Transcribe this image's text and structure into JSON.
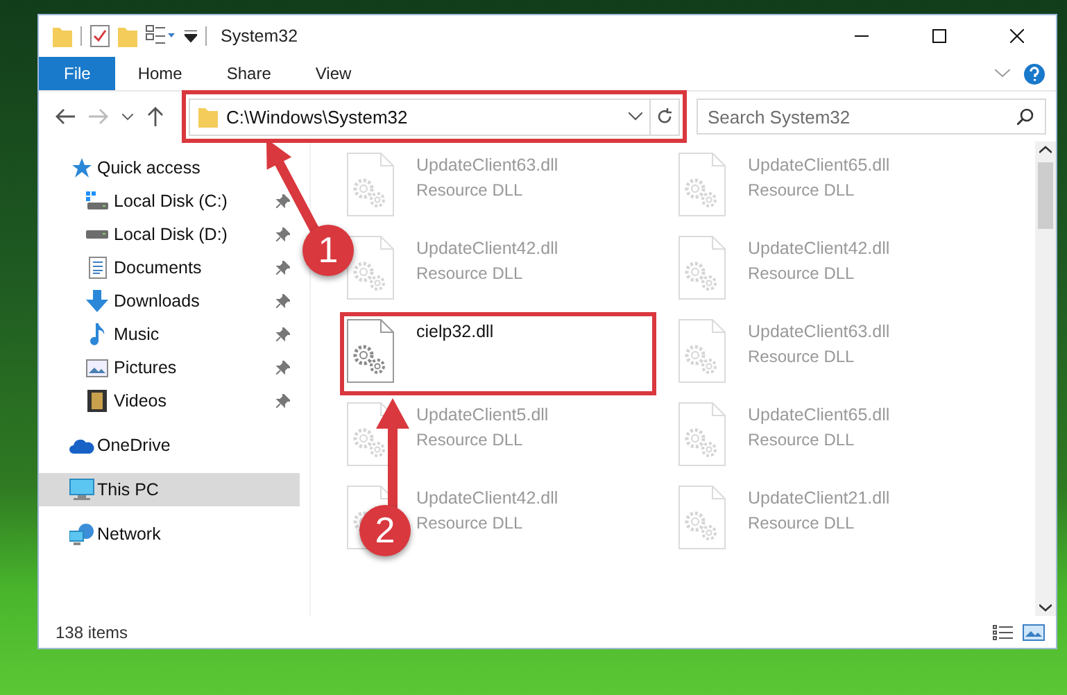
{
  "window": {
    "title": "System32"
  },
  "ribbon_tabs": [
    {
      "label": "File",
      "kind": "file",
      "selected": false
    },
    {
      "label": "Home",
      "kind": "tab",
      "selected": false
    },
    {
      "label": "Share",
      "kind": "tab",
      "selected": false
    },
    {
      "label": "View",
      "kind": "tab",
      "selected": false
    }
  ],
  "address_bar": {
    "path": "C:\\Windows\\System32"
  },
  "search": {
    "placeholder": "Search System32"
  },
  "navigation": [
    {
      "label": "Quick access",
      "kind": "star",
      "selected": false,
      "children": [
        {
          "label": "Local Disk (C:)",
          "kind": "system-drive",
          "selected": false,
          "pinned": true
        },
        {
          "label": "Local Disk (D:)",
          "kind": "drive",
          "selected": false,
          "pinned": true
        },
        {
          "label": "Documents",
          "kind": "documents",
          "selected": false,
          "pinned": true
        },
        {
          "label": "Downloads",
          "kind": "downloads",
          "selected": false,
          "pinned": true
        },
        {
          "label": "Music",
          "kind": "music",
          "selected": false,
          "pinned": true
        },
        {
          "label": "Pictures",
          "kind": "pictures",
          "selected": false,
          "pinned": true
        },
        {
          "label": "Videos",
          "kind": "videos",
          "selected": false,
          "pinned": true
        }
      ]
    },
    {
      "label": "OneDrive",
      "kind": "cloud",
      "selected": false
    },
    {
      "label": "This PC",
      "kind": "computer",
      "selected": true
    },
    {
      "label": "Network",
      "kind": "network",
      "selected": false
    }
  ],
  "files": [
    {
      "name": "UpdateClient63.dll",
      "type": "Resource DLL",
      "blurred": true
    },
    {
      "name": "UpdateClient65.dll",
      "type": "Resource DLL",
      "blurred": true
    },
    {
      "name": "UpdateClient42.dll",
      "type": "Resource DLL",
      "blurred": true
    },
    {
      "name": "UpdateClient42.dll",
      "type": "Resource DLL",
      "blurred": true
    },
    {
      "name": "cielp32.dll",
      "blurred": false
    },
    {
      "name": "UpdateClient63.dll",
      "type": "Resource DLL",
      "blurred": true
    },
    {
      "name": "UpdateClient5.dll",
      "type": "Resource DLL",
      "blurred": true
    },
    {
      "name": "UpdateClient65.dll",
      "type": "Resource DLL",
      "blurred": true
    },
    {
      "name": "UpdateClient42.dll",
      "type": "Resource DLL",
      "blurred": true
    },
    {
      "name": "UpdateClient21.dll",
      "type": "Resource DLL",
      "blurred": true
    }
  ],
  "status_bar": {
    "item_count": "138 items"
  },
  "annotations": [
    {
      "number": "1"
    },
    {
      "number": "2"
    }
  ]
}
